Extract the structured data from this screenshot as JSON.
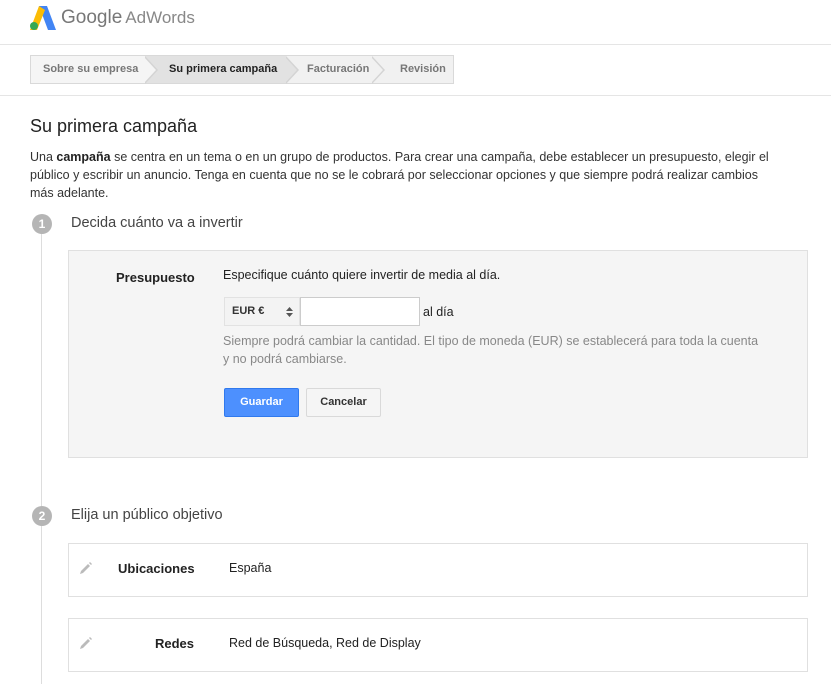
{
  "header": {
    "brand_google": "Google",
    "brand_product": "AdWords"
  },
  "steps": [
    {
      "label": "Sobre su empresa"
    },
    {
      "label": "Su primera campaña"
    },
    {
      "label": "Facturación"
    },
    {
      "label": "Revisión"
    }
  ],
  "main": {
    "title": "Su primera campaña",
    "intro_prefix": "Una ",
    "intro_bold": "campaña",
    "intro_rest": " se centra en un tema o en un grupo de productos. Para crear una campaña, debe establecer un presupuesto, elegir el público y escribir un anuncio. Tenga en cuenta que no se le cobrará por seleccionar opciones y que siempre podrá realizar cambios más adelante."
  },
  "section1": {
    "number": "1",
    "title": "Decida cuánto va a invertir",
    "budget_label": "Presupuesto",
    "budget_desc": "Especifique cuánto quiere invertir de media al día.",
    "currency_value": "EUR €",
    "amount_value": "",
    "per_day": "al día",
    "hint": "Siempre podrá cambiar la cantidad. El tipo de moneda (EUR) se establecerá para toda la cuenta y no podrá cambiarse.",
    "save_label": "Guardar",
    "cancel_label": "Cancelar"
  },
  "section2": {
    "number": "2",
    "title": "Elija un público objetivo",
    "rows": [
      {
        "label": "Ubicaciones",
        "value": "España"
      },
      {
        "label": "Redes",
        "value": "Red de Búsqueda, Red de Display"
      }
    ]
  },
  "colors": {
    "primary_button": "#4d90fe",
    "active_step": "#e2e2e2",
    "logo_blue": "#4285f4",
    "logo_green": "#34a853",
    "logo_yellow": "#fbbc05"
  }
}
